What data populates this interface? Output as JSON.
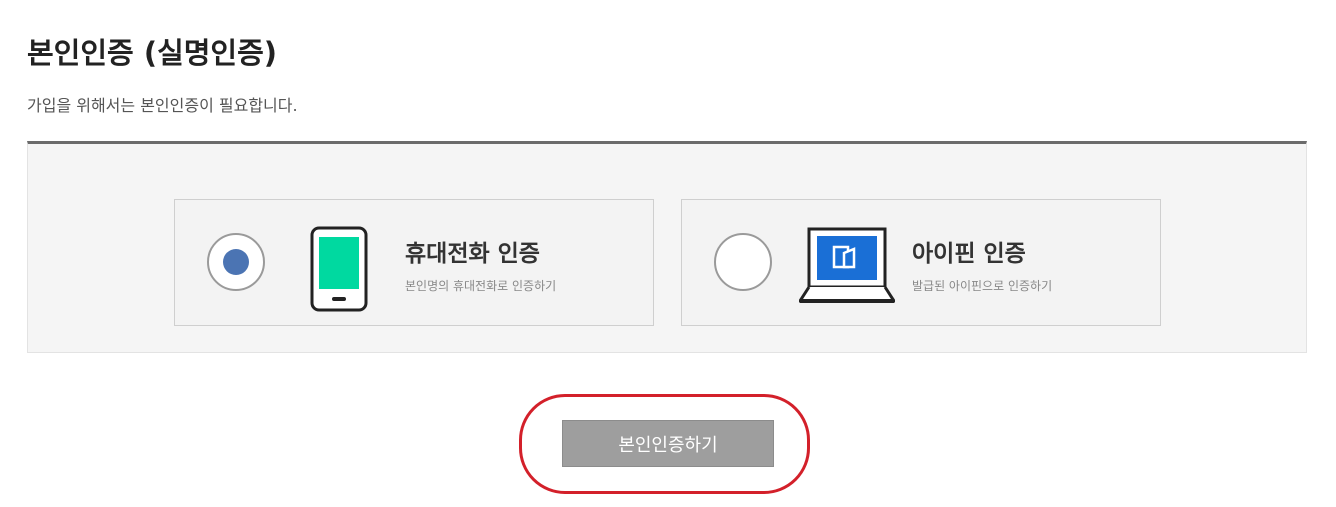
{
  "header": {
    "title": "본인인증 (실명인증)",
    "description": "가입을 위해서는 본인인증이 필요합니다."
  },
  "options": [
    {
      "id": "phone",
      "title": "휴대전화 인증",
      "subtitle": "본인명의 휴대전화로 인증하기",
      "selected": true,
      "icon": "mobile-phone-icon"
    },
    {
      "id": "ipin",
      "title": "아이핀 인증",
      "subtitle": "발급된 아이핀으로 인증하기",
      "selected": false,
      "icon": "laptop-ipin-icon"
    }
  ],
  "actions": {
    "verify_label": "본인인증하기"
  },
  "colors": {
    "radio_selected": "#4b74b3",
    "phone_screen": "#00d9a0",
    "laptop_screen": "#1a6fd6",
    "button_bg": "#9e9e9e",
    "highlight": "#d3202a"
  }
}
